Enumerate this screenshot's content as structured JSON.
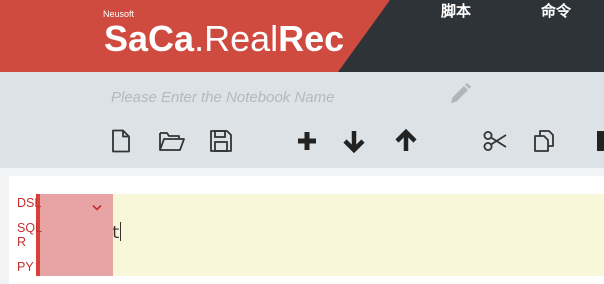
{
  "header": {
    "brand_super": "Neusoft",
    "brand_parts": [
      "Sa",
      "C",
      "a",
      ".",
      "Real",
      "Rec"
    ],
    "nav": [
      "脚本",
      "命令"
    ]
  },
  "notebook": {
    "name_placeholder": "Please Enter the Notebook Name",
    "name_value": ""
  },
  "toolbar": {
    "icons": [
      "new-file-icon",
      "open-folder-icon",
      "save-icon",
      "add-icon",
      "move-down-icon",
      "move-up-icon",
      "cut-icon",
      "copy-icon"
    ]
  },
  "cell": {
    "text": "st",
    "languages": [
      "DSL",
      "SQL",
      "R",
      "PY"
    ],
    "selected_language": "DSL"
  },
  "colors": {
    "header_bg": "#2e3338",
    "brand_red": "#cf4a3f",
    "toolbar_bg": "#dde2e6",
    "editor_bg": "#f8f7d9",
    "lang_panel": "#e8a4a4",
    "lang_text": "#c62f2f"
  }
}
